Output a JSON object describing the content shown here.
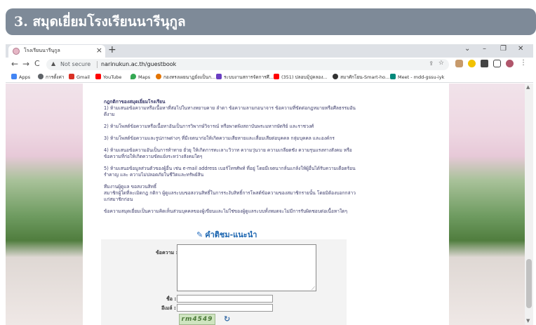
{
  "slide": {
    "title": "3. สมุดเยี่ยมโรงเรียนนารีนุกูล"
  },
  "browser": {
    "tab_title": "โรงเรียนนารีนุกูล",
    "tab_close": "×",
    "new_tab": "+",
    "window_controls": {
      "dropdown": "⌄",
      "minimize": "–",
      "restore": "❐",
      "close": "✕"
    },
    "nav": {
      "back": "←",
      "forward": "→",
      "reload": "C"
    },
    "address": {
      "security_label": "Not secure",
      "url": "narinukun.ac.th/guestbook"
    },
    "bookmarks": [
      {
        "label": "Apps",
        "color": "#ea4335"
      },
      {
        "label": "การตั้งค่า",
        "color": "#5f6368"
      },
      {
        "label": "Gmail",
        "color": "#d93025"
      },
      {
        "label": "YouTube",
        "color": "#ff0000"
      },
      {
        "label": "Maps",
        "color": "#34a853"
      },
      {
        "label": "กองทรงเผยนาฏยั่งแป็นก...",
        "color": "#e37400"
      },
      {
        "label": "ระบบงานสการจัดการศึ...",
        "color": "#6a3ec2"
      },
      {
        "label": "(351) ปลอบมุ้ปุคลอง...",
        "color": "#ff0000"
      },
      {
        "label": "สมาศักโยน-Smart-ho...",
        "color": "#333333"
      },
      {
        "label": "Meet - mdd-gssu-iyk",
        "color": "#00897b"
      }
    ]
  },
  "page": {
    "rules_heading": "กฎกติกาของสมุดเยี่ยมโรงเรียน",
    "rules": [
      "1) ห้ามเสนอข้อความหรือเนื้อหาที่ส่อไปในทางหยาบคาย ลำดา ข้อความลามกอนาจาร ข้อความที่ขัดต่อกฎหมายหรือศีลธรรมอันดีงาม",
      "2) ห้ามโพสต์ข้อความหรือเนื้อหาอันเป็นการวิพากษ์วิจารณ์ หรือพาดพิงสถาบันพระมหากษัตริย์ และราชวงศ์",
      "3) ห้ามโพสต์ข้อความและรูปภาพต่างๆ ที่มีเจตนาก่อให้เกิดความเสียหายและเสื่อมเสียต่อบุคคล กลุ่มบุคคล และองค์กร",
      "4) ห้ามเสนอข้อความอันเป็นการท้าทาย ยั่วยุ ให้เกิดการทะเลาะวิวาท ความวุ่นวาย ความเกลียดชัง ความรุนแรงทางสังคม หรือ ข้อความที่ก่อให้เกิดความขัดแย้งระหว่างสังคมใดๆ",
      "5) ห้ามเสนอข้อมูลส่วนตัวของผู้อื่น เช่น e-mail address เบอร์โทรศัพท์ ที่อยู่ โดยมีเจตนากลั่นแกล้งให้ผู้อื่นได้รับความเดือดร้อนรำคาญ และ ความไม่ปลอดภัยในชีวิตและทรัพย์สิน"
    ],
    "admin_note_1": "ทีมงานผู้ดูแล ขอสงวนสิทธิ์",
    "admin_note_2": "สมาชิกผู้ใดที่ละเมิดกฎ กติกา ผู้ดูแลระบบขอสงวนสิทธิ์ในการระงับสิทธิ์การโพสต์ข้อความของสมาชิกรายนั้น โดยมิต้องบอกกล่าวแก่สมาชิกก่อน",
    "disclaimer": "ข้อความสมุดเยี่ยมเป็นความคิดเห็นส่วนบุคคลของผู้เขียนและไม่ใช่ของผู้ดูแลระบบทั้งหมดจะไม่มีการรับผิดชอบต่อเนื้อหาใดๆ",
    "form_heading": "คำติชม-แนะนำ",
    "labels": {
      "message": "ข้อความ :",
      "name": "ชื่อ :",
      "email": "อีเมล์ :"
    },
    "inputs": {
      "message": "",
      "name": "",
      "email": ""
    },
    "captcha_text": "rm4549"
  }
}
